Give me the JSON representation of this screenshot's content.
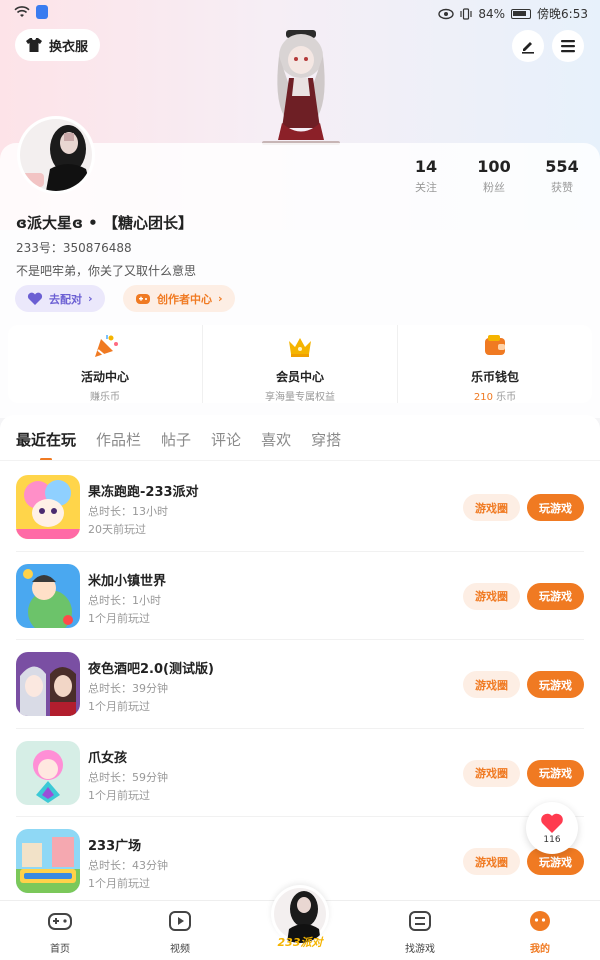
{
  "status_bar": {
    "battery": "84%",
    "time": "傍晚6:53"
  },
  "header": {
    "outfit_label": "换衣服"
  },
  "profile": {
    "username": "ɞ派大星ɞ • 【糖心团长】",
    "uid": "233号：350876488",
    "bio": "不是吧牢弟，你关了又取什么意思",
    "stats": [
      {
        "value": "14",
        "label": "关注"
      },
      {
        "value": "100",
        "label": "粉丝"
      },
      {
        "value": "554",
        "label": "获赞"
      }
    ],
    "match_label": "去配对",
    "creator_label": "创作者中心"
  },
  "features": [
    {
      "title": "活动中心",
      "sub": "赚乐币",
      "icon": "party-popper-icon"
    },
    {
      "title": "会员中心",
      "sub": "享海量专属权益",
      "icon": "crown-icon"
    },
    {
      "title": "乐币钱包",
      "sub_value": "210",
      "sub_unit": " 乐币",
      "icon": "wallet-icon"
    }
  ],
  "tabs": [
    "最近在玩",
    "作品栏",
    "帖子",
    "评论",
    "喜欢",
    "穿搭"
  ],
  "games": [
    {
      "name": "果冻跑跑-233派对",
      "duration_label": "总时长：",
      "duration": "13小时",
      "last_played": "20天前玩过",
      "circle_label": "游戏圈",
      "play_label": "玩游戏"
    },
    {
      "name": "米加小镇世界",
      "duration_label": "总时长：",
      "duration": "1小时",
      "last_played": "1个月前玩过",
      "circle_label": "游戏圈",
      "play_label": "玩游戏"
    },
    {
      "name": "夜色酒吧2.0(测试版)",
      "duration_label": "总时长：",
      "duration": "39分钟",
      "last_played": "1个月前玩过",
      "circle_label": "游戏圈",
      "play_label": "玩游戏"
    },
    {
      "name": "爪女孩",
      "duration_label": "总时长：",
      "duration": "59分钟",
      "last_played": "1个月前玩过",
      "circle_label": "游戏圈",
      "play_label": "玩游戏"
    },
    {
      "name": "233广场",
      "duration_label": "总时长：",
      "duration": "43分钟",
      "last_played": "1个月前玩过",
      "circle_label": "游戏圈",
      "play_label": "玩游戏"
    }
  ],
  "like_float": {
    "count": "116"
  },
  "bottom_nav": [
    {
      "label": "首页",
      "icon": "gamepad-icon"
    },
    {
      "label": "视频",
      "icon": "video-icon"
    },
    {
      "label": "233派对",
      "icon": "party-avatar"
    },
    {
      "label": "找游戏",
      "icon": "list-icon"
    },
    {
      "label": "我的",
      "icon": "profile-face-icon"
    }
  ],
  "colors": {
    "accent": "#f07a22",
    "accent_light": "#fdeee4",
    "match": "#6b5fd3",
    "badge_yellow": "#f5b400"
  }
}
